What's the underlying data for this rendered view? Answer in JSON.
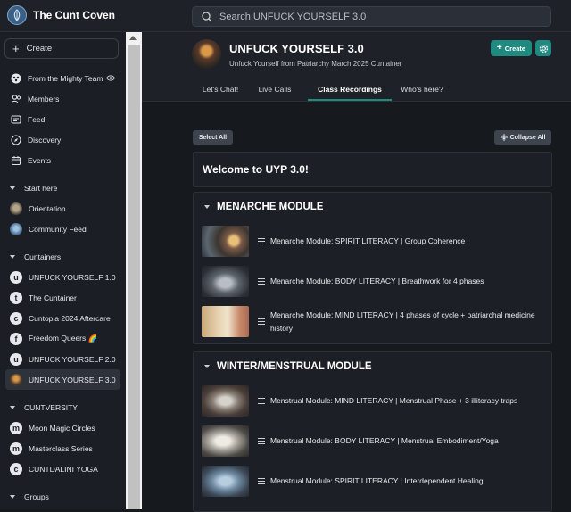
{
  "app": {
    "name": "The Cunt Coven"
  },
  "search": {
    "placeholder": "Search UNFUCK YOURSELF 3.0"
  },
  "sidebar": {
    "create_label": "Create",
    "top_items": [
      {
        "label": "From the Mighty Team",
        "icon": "sparkle-icon"
      },
      {
        "label": "Members",
        "icon": "members-icon"
      },
      {
        "label": "Feed",
        "icon": "feed-icon"
      },
      {
        "label": "Discovery",
        "icon": "compass-icon"
      },
      {
        "label": "Events",
        "icon": "calendar-icon"
      }
    ],
    "start_here": {
      "title": "Start here",
      "items": [
        {
          "label": "Orientation"
        },
        {
          "label": "Community Feed"
        }
      ]
    },
    "cuntainers": {
      "title": "Cuntainers",
      "items": [
        {
          "label": "UNFUCK YOURSELF 1.0",
          "letter": "u"
        },
        {
          "label": "The Cuntainer",
          "letter": "t"
        },
        {
          "label": "Cuntopia 2024 Aftercare",
          "letter": "c"
        },
        {
          "label": "Freedom Queers 🌈",
          "letter": "f"
        },
        {
          "label": "UNFUCK YOURSELF 2.0",
          "letter": "u"
        },
        {
          "label": "UNFUCK YOURSELF 3.0",
          "letter": ""
        }
      ]
    },
    "cuntversity": {
      "title": "CUNTVERSITY",
      "items": [
        {
          "label": "Moon Magic Circles",
          "letter": "m"
        },
        {
          "label": "Masterclass Series",
          "letter": "m"
        },
        {
          "label": "CUNTDALINI YOGA",
          "letter": "c"
        }
      ]
    },
    "groups": {
      "title": "Groups"
    }
  },
  "group": {
    "title": "UNFUCK YOURSELF 3.0",
    "subtitle": "Unfuck Yourself from Patriarchy March 2025 Cuntainer",
    "create_label": "Create",
    "tabs": [
      "Let's Chat!",
      "Live Calls",
      "Class Recordings",
      "Who's here?"
    ],
    "active_tab": "Class Recordings"
  },
  "toolbar": {
    "select_all": "Select All",
    "collapse_all": "Collapse All"
  },
  "welcome": {
    "title": "Welcome to UYP 3.0!"
  },
  "modules": [
    {
      "title": "MENARCHE MODULE",
      "lessons": [
        "Menarche Module: SPIRIT LITERACY | Group Coherence",
        "Menarche Module: BODY LITERACY | Breathwork for 4 phases",
        "Menarche Module: MIND LITERACY | 4 phases of cycle + patriarchal medicine history"
      ]
    },
    {
      "title": "WINTER/MENSTRUAL MODULE",
      "lessons": [
        "Menstrual Module: MIND LITERACY | Menstrual Phase + 3 illiteracy traps",
        "Menstrual Module: BODY LITERACY | Menstrual Embodiment/Yoga",
        "Menstrual Module: SPIRIT LITERACY | Interdependent Healing"
      ]
    }
  ],
  "colors": {
    "accent": "#1f8a80",
    "background": "#161a1f",
    "sidebar": "#1b1f25"
  }
}
